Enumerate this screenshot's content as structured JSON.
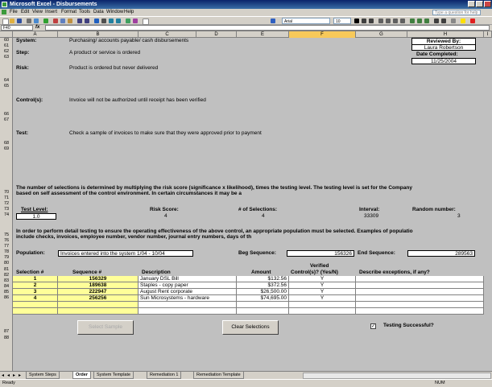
{
  "window": {
    "title": "Microsoft Excel - Disbursements"
  },
  "menu": [
    "File",
    "Edit",
    "View",
    "Insert",
    "Format",
    "Tools",
    "Data",
    "Window",
    "Help"
  ],
  "help_placeholder": "Type a question for help",
  "toolbar": {
    "font": "Arial",
    "size": "10"
  },
  "formula_bar": {
    "name_box": "F40",
    "fx": "fx",
    "value": ""
  },
  "columns": [
    "A",
    "B",
    "C",
    "D",
    "E",
    "F",
    "G",
    "H",
    "I"
  ],
  "rows": [
    "60",
    "61",
    "62",
    "63",
    "",
    "64",
    "65",
    "",
    "66",
    "67",
    "",
    "68",
    "69",
    "",
    "",
    "70",
    "71",
    "72",
    "73",
    "74",
    "",
    "75",
    "76",
    "77",
    "78",
    "79",
    "80",
    "81",
    "82",
    "83",
    "84",
    "85",
    "86",
    "",
    "",
    "87",
    "88"
  ],
  "sheet": {
    "system_label": "System:",
    "system_value": "Purchasing/ accounts payable/ cash disbursements",
    "step_label": "Step:",
    "step_value": "A product or service is ordered",
    "risk_label": "Risk:",
    "risk_value": "Product is ordered but never delivered",
    "controls_label": "Control(s):",
    "controls_value": "Invoice will not be authorized until receipt has been verified",
    "test_label": "Test:",
    "test_value": "Check a sample of invoices to make sure that they were approved prior to payment",
    "reviewed_by_label": "Reviewed By:",
    "reviewed_by_value": "Laura Robertson",
    "date_completed_label": "Date Completed:",
    "date_completed_value": "11/25/2004",
    "selection_text_1": "The number of selections is determined by multiplying the risk score (significance x likelihood), times the testing level.  The testing level is set for the Company",
    "selection_text_2": "based on self assessment of the control environment.  In certain circumstances it may be a",
    "test_level_label": "Test Level:",
    "test_level_value": "1.0",
    "risk_score_label": "Risk Score:",
    "risk_score_value": "4",
    "num_selections_label": "# of Selections:",
    "num_selections_value": "4",
    "interval_label": "Interval:",
    "interval_value": "33309",
    "random_number_label": "Random number:",
    "random_number_value": "3",
    "population_text_1": "In order to perform detail testing to ensure the operating effectiveness of the above control, an appropriate population must be selected.  Examples of populatio",
    "population_text_2": "include checks, invoices, employee number, vendor number, journal entry numbers, days of th",
    "population_label": "Population:",
    "population_value": "Invoices entered into the system 1/04 - 10/04",
    "beg_sequence_label": "Beg Sequence:",
    "beg_sequence_value": "156326",
    "end_sequence_label": "End Sequence:",
    "end_sequence_value": "289563",
    "verified_header_1": "Verified",
    "table_headers": [
      "Selection #",
      "Sequence #",
      "Description",
      "Amount",
      "Control(s)? (Yes/N)",
      "Describe exceptions, if any?"
    ],
    "table_rows": [
      {
        "sel": "1",
        "seq": "156329",
        "desc": "January DSL Bill",
        "amount": "$132.56",
        "verified": "Y"
      },
      {
        "sel": "2",
        "seq": "189638",
        "desc": "Staples - copy paper",
        "amount": "$372.56",
        "verified": "Y"
      },
      {
        "sel": "3",
        "seq": "222947",
        "desc": "August Rent corporate",
        "amount": "$26,500.00",
        "verified": "Y"
      },
      {
        "sel": "4",
        "seq": "256256",
        "desc": "Sun Microsystems - hardware",
        "amount": "$74,695.00",
        "verified": "Y"
      }
    ],
    "select_sample_button": "Select Sample",
    "clear_selections_button": "Clear Selections",
    "testing_successful_label": "Testing Successful?",
    "testing_successful_checked": "✓"
  },
  "sheet_tabs": [
    "System Steps",
    "Order",
    "System Template",
    "Remediation 1",
    "Remediation Template"
  ],
  "active_tab": "Order",
  "status": "Ready",
  "status_right": "NUM"
}
